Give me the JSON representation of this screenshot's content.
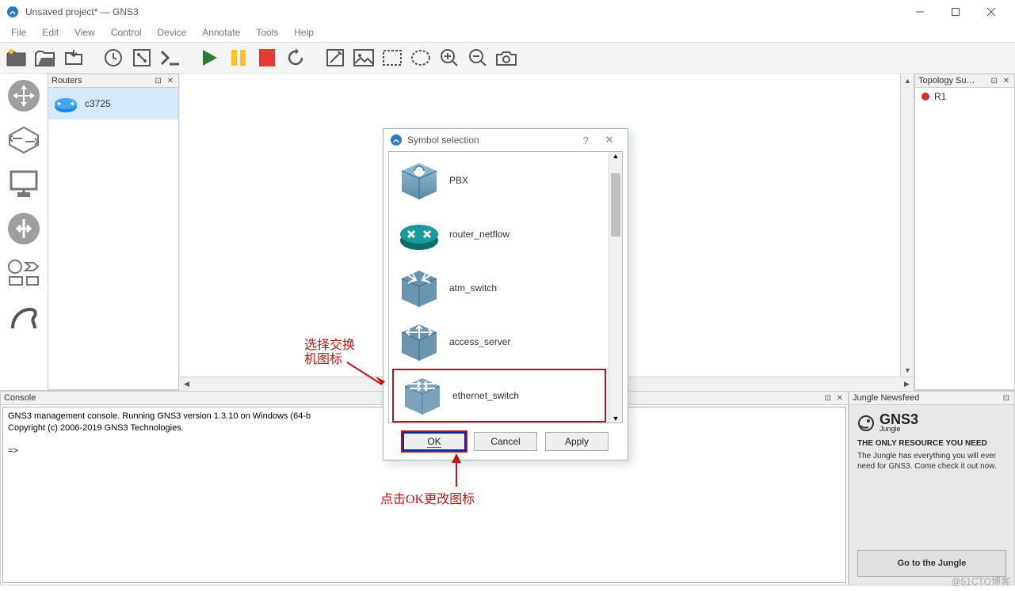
{
  "window": {
    "title": "Unsaved project* — GNS3"
  },
  "menu": [
    "File",
    "Edit",
    "View",
    "Control",
    "Device",
    "Annotate",
    "Tools",
    "Help"
  ],
  "routers": {
    "title": "Routers",
    "items": [
      {
        "label": "c3725"
      }
    ]
  },
  "topology": {
    "title": "Topology Su…",
    "items": [
      {
        "label": "R1"
      }
    ]
  },
  "console": {
    "title": "Console",
    "line1": "GNS3 management console. Running GNS3 version 1.3.10 on Windows (64-b",
    "line2": "Copyright (c) 2006-2019 GNS3 Technologies.",
    "prompt": "=>"
  },
  "jungle": {
    "title": "Jungle Newsfeed",
    "brand_top": "GNS3",
    "brand_bottom": "Jungle",
    "tagline": "THE ONLY RESOURCE YOU NEED",
    "desc": "The Jungle has everything you will ever need for GNS3. Come check it out now.",
    "button": "Go to the Jungle"
  },
  "modal": {
    "title": "Symbol selection",
    "items": [
      {
        "label": "PBX"
      },
      {
        "label": "router_netflow"
      },
      {
        "label": "atm_switch"
      },
      {
        "label": "access_server"
      },
      {
        "label": "ethernet_switch"
      }
    ],
    "ok": "OK",
    "cancel": "Cancel",
    "apply": "Apply"
  },
  "annotations": {
    "select_switch": "选择交换\n机图标",
    "click_ok": "点击OK更改图标"
  },
  "watermark": "@51CTO博客"
}
